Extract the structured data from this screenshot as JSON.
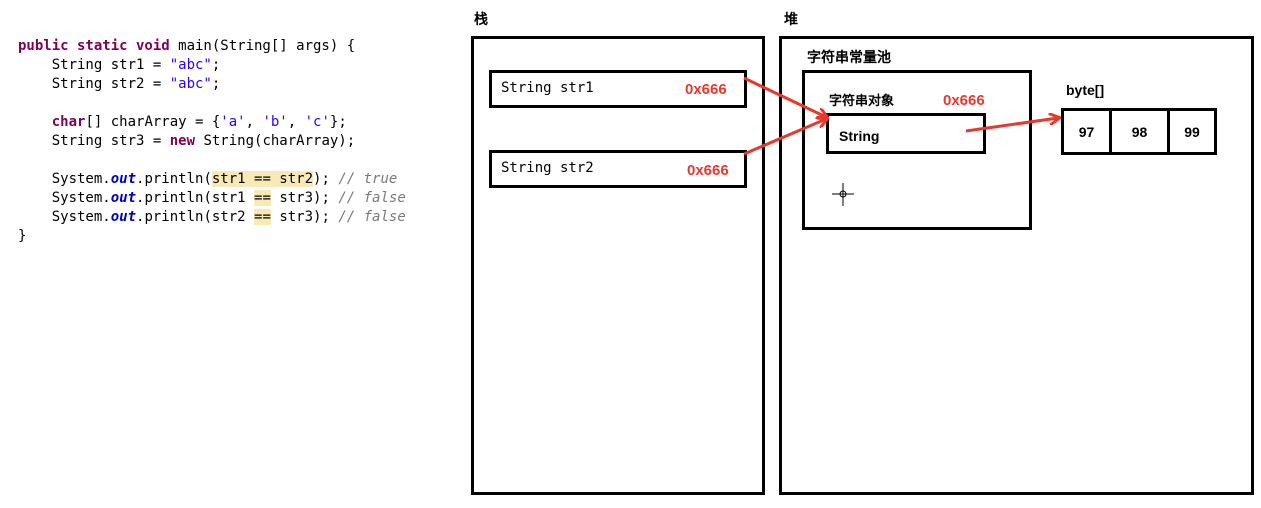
{
  "code": {
    "lines": [
      [
        {
          "t": "public static void",
          "c": "kw"
        },
        {
          "t": " main(String[] args) {"
        }
      ],
      [
        {
          "t": "    String str1 = "
        },
        {
          "t": "\"abc\"",
          "c": "str"
        },
        {
          "t": ";"
        }
      ],
      [
        {
          "t": "    String str2 = "
        },
        {
          "t": "\"abc\"",
          "c": "str"
        },
        {
          "t": ";"
        }
      ],
      [],
      [
        {
          "t": "    "
        },
        {
          "t": "char",
          "c": "kw"
        },
        {
          "t": "[] charArray = {"
        },
        {
          "t": "'a'",
          "c": "chr"
        },
        {
          "t": ", "
        },
        {
          "t": "'b'",
          "c": "chr"
        },
        {
          "t": ", "
        },
        {
          "t": "'c'",
          "c": "chr"
        },
        {
          "t": "};"
        }
      ],
      [
        {
          "t": "    String str3 = "
        },
        {
          "t": "new",
          "c": "kw"
        },
        {
          "t": " String(charArray);"
        }
      ],
      [],
      [
        {
          "t": "    System."
        },
        {
          "t": "out",
          "c": "field"
        },
        {
          "t": ".println("
        },
        {
          "t": "str1 == str2",
          "c": "hl"
        },
        {
          "t": "); "
        },
        {
          "t": "// true",
          "c": "com"
        }
      ],
      [
        {
          "t": "    System."
        },
        {
          "t": "out",
          "c": "field"
        },
        {
          "t": ".println(str1 "
        },
        {
          "t": "==",
          "c": "hl"
        },
        {
          "t": " str3); "
        },
        {
          "t": "// false",
          "c": "com"
        }
      ],
      [
        {
          "t": "    System."
        },
        {
          "t": "out",
          "c": "field"
        },
        {
          "t": ".println(str2 "
        },
        {
          "t": "==",
          "c": "hl"
        },
        {
          "t": " str3); "
        },
        {
          "t": "// false",
          "c": "com"
        }
      ],
      [
        {
          "t": "}"
        }
      ]
    ]
  },
  "diagram": {
    "stack_label": "栈",
    "heap_label": "堆",
    "string_pool_label": "字符串常量池",
    "string_object_label": "字符串对象",
    "string_object_addr": "0x666",
    "string_inner_label": "String",
    "byte_array_label": "byte[]",
    "byte_values": [
      "97",
      "98",
      "99"
    ],
    "stack_vars": [
      {
        "name": "String str1",
        "addr": "0x666"
      },
      {
        "name": "String str2",
        "addr": "0x666"
      }
    ],
    "colors": {
      "arrow": "#e8392f",
      "address": "#e8392f",
      "border": "#000000",
      "keyword": "#7f0055",
      "string_literal": "#2a00ff",
      "comment": "#7a7a7a",
      "highlight": "#f9e9b8"
    },
    "icons": [
      "crosshair-cursor-icon"
    ]
  }
}
